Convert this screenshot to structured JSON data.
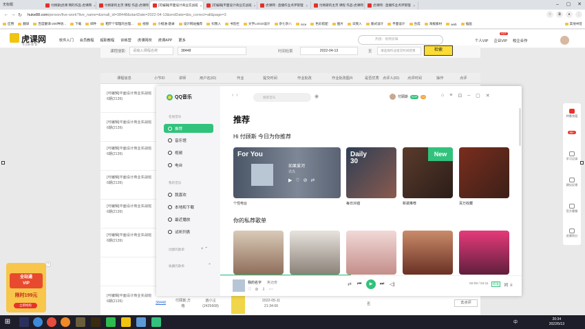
{
  "browser": {
    "window_title": "无标题",
    "tabs": [
      "付顾斯|虎课 网的作品-虎课网",
      "付顾斯的主页 课程 作品-虎课网",
      "[可编辑]平面设计商业实战班",
      "[可编辑]平面设计商业实战班",
      "虎课网 - 直播作业点评管理",
      "付顾斯的主页 课程 作品-虎课网",
      "虎课网 - 直播作业点评管理"
    ],
    "url_host": "huke88.com",
    "url_path": "/person/live-work?live_name=&small_id=38448&startDate=2022-04-13&endDate=&is_correct=all&page=3",
    "bookmarks": [
      "应用",
      "翻译",
      "百度翻译-200种语...",
      "下载",
      "邮件",
      "粗吓个帮理的台理...",
      "视频",
      "小橙通-题录",
      "设计网站推荐",
      "扫我入",
      "书签栏",
      "文字LOGO设计",
      "杂七杂八",
      "nice",
      "色彩搭配",
      "图片",
      "日我入",
      "版式设计",
      "平面设计",
      "合成",
      "海报素材",
      "web",
      "插画",
      "其他书签"
    ]
  },
  "site": {
    "logo_text": "虎课网",
    "logo_sub": "专注新 教 育",
    "nav": [
      "软件入门",
      "会员教程",
      "超职教程",
      "训练营",
      "虎课网校",
      "虎课APP",
      "更多"
    ],
    "search_placeholder": "热搜：视频剪辑",
    "right_nav": [
      "个人VIP",
      "企业VIP",
      "校企合作"
    ],
    "hot": "HOT"
  },
  "filter": {
    "course_label": "课程搜索:",
    "course_placeholder": "请输入课程名称",
    "id_value": "38448",
    "time_label": "时间检索",
    "date_value": "2022-04-13",
    "to": "至",
    "end_placeholder": "请选择作业提交时间结束",
    "search_btn": "检索"
  },
  "table": {
    "headers": [
      "课程信息",
      "小节ID",
      "讲师",
      "用户名(ID)",
      "作业",
      "提交时间",
      "作业批改",
      "作业批改图片",
      "是否优秀",
      "点评人(ID)",
      "点评时间",
      "操作",
      "点评"
    ],
    "row_title": "[可编辑]平面设计商业实战班6期(2139)",
    "last_row": {
      "id": "38448",
      "teacher": "付顾斯,方格",
      "user": "逍小尘(2425608)",
      "time": "2022-05-11 21:34:06",
      "excellent": "否",
      "action": "去点评"
    }
  },
  "right_sidebar": [
    "特惠充值",
    "学习记录",
    "建议反馈",
    "官方客服",
    "虎课积分"
  ],
  "right_sidebar_badge": "99+",
  "qq": {
    "logo": "QQ音乐",
    "search_placeholder": "搜索音乐",
    "sections": {
      "online": "在线音乐",
      "mine": "我的音乐",
      "created": "创建的歌单",
      "fav": "收藏的歌单"
    },
    "online_items": [
      "推荐",
      "音乐馆",
      "视频",
      "电台"
    ],
    "my_items": [
      "我喜欢",
      "本地和下载",
      "最近播放",
      "试听列表"
    ],
    "user": "付顾斯",
    "badges": [
      "SVIP",
      "LV"
    ],
    "title": "推荐",
    "greeting": "Hi 付顾斯 今日为你推荐",
    "cards": [
      {
        "caption": "个性电台",
        "overlay": "For You",
        "song": "如果爱河",
        "artist": "讯鸟"
      },
      {
        "caption": "每日30首",
        "overlay": "Daily 30"
      },
      {
        "caption": "新歌推荐",
        "overlay": "New"
      },
      {
        "caption": "百万收藏"
      }
    ],
    "playlist_title": "你的私荐歌单",
    "player": {
      "song": "我的名字",
      "artist": "焦迈奇",
      "time": "02:09 / 04:11",
      "quality": "标准"
    }
  },
  "ad": {
    "top1": "全站通",
    "top2": "VIP",
    "price": "限时199元",
    "btn": "立即抢购"
  },
  "taskbar": {
    "time": "20:34",
    "date": "2022/5/13",
    "ime": "中"
  },
  "watermark": "虎课网"
}
